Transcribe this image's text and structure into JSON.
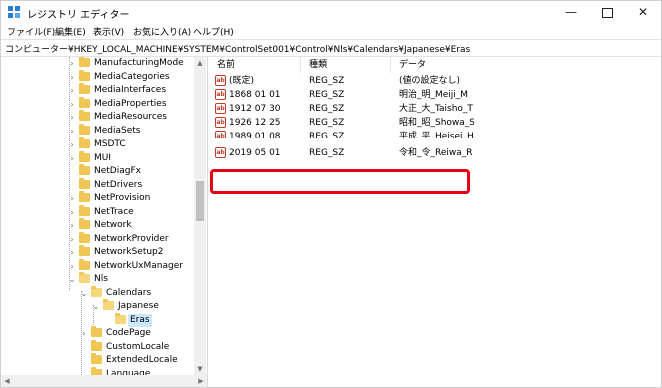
{
  "window": {
    "title": "レジストリ エディター",
    "min_glyph": "—",
    "close_glyph": "✕"
  },
  "menu": [
    "ファイル(F)",
    "編集(E)",
    "表示(V)",
    "お気に入り(A)",
    "ヘルプ(H)"
  ],
  "address": "コンピューター¥HKEY_LOCAL_MACHINE¥SYSTEM¥ControlSet001¥Control¥Nls¥Calendars¥Japanese¥Eras",
  "tree": [
    {
      "label": "ManufacturingMode",
      "arrow": "›"
    },
    {
      "label": "MediaCategories",
      "arrow": "›"
    },
    {
      "label": "MediaInterfaces",
      "arrow": "›"
    },
    {
      "label": "MediaProperties",
      "arrow": "›"
    },
    {
      "label": "MediaResources",
      "arrow": "›"
    },
    {
      "label": "MediaSets",
      "arrow": "›"
    },
    {
      "label": "MSDTC",
      "arrow": "›"
    },
    {
      "label": "MUI",
      "arrow": "›"
    },
    {
      "label": "NetDiagFx",
      "arrow": ""
    },
    {
      "label": "NetDrivers",
      "arrow": ""
    },
    {
      "label": "NetProvision",
      "arrow": "›"
    },
    {
      "label": "NetTrace",
      "arrow": "›"
    },
    {
      "label": "Network",
      "arrow": "›"
    },
    {
      "label": "NetworkProvider",
      "arrow": "›"
    },
    {
      "label": "NetworkSetup2",
      "arrow": "›"
    },
    {
      "label": "NetworkUxManager",
      "arrow": "›"
    },
    {
      "label": "Nls",
      "arrow": "⌄"
    },
    {
      "label": "Calendars",
      "arrow": "⌄"
    },
    {
      "label": "Japanese",
      "arrow": "⌄"
    },
    {
      "label": "Eras",
      "arrow": ""
    },
    {
      "label": "CodePage",
      "arrow": "›"
    },
    {
      "label": "CustomLocale",
      "arrow": ""
    },
    {
      "label": "ExtendedLocale",
      "arrow": ""
    },
    {
      "label": "Language",
      "arrow": ""
    }
  ],
  "columns": [
    "名前",
    "種類",
    "データ"
  ],
  "values": [
    {
      "name": "(既定)",
      "type": "REG_SZ",
      "data": "(値の設定なし)"
    },
    {
      "name": "1868 01 01",
      "type": "REG_SZ",
      "data": "明治_明_Meiji_M"
    },
    {
      "name": "1912 07 30",
      "type": "REG_SZ",
      "data": "大正_大_Taisho_T"
    },
    {
      "name": "1926 12 25",
      "type": "REG_SZ",
      "data": "昭和_昭_Showa_S"
    },
    {
      "name": "1989 01 08",
      "type": "REG_SZ",
      "data": "平成_平_Heisei_H"
    },
    {
      "name": "2019 05 01",
      "type": "REG_SZ",
      "data": "令和_令_Reiwa_R"
    }
  ],
  "value_icon_text": "ab",
  "highlight_color": "#e60012"
}
